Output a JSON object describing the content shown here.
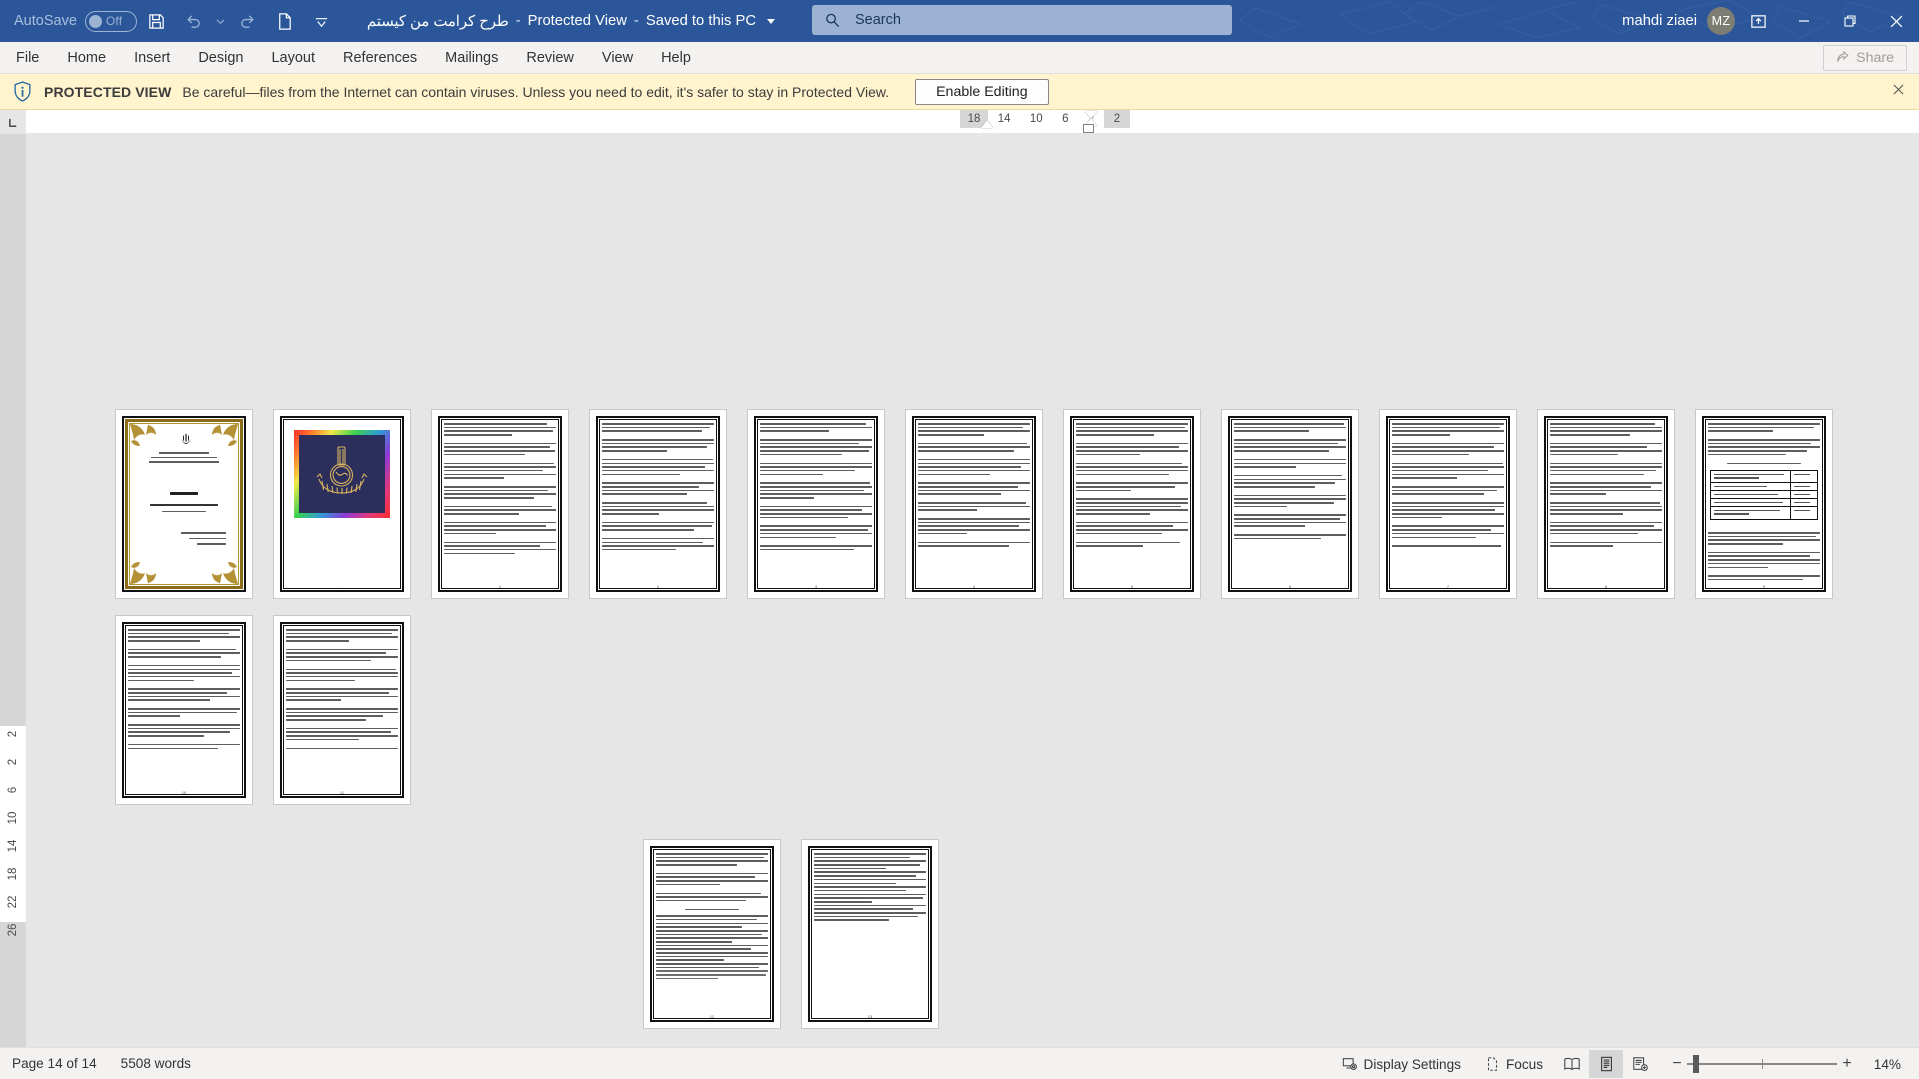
{
  "titlebar": {
    "autosave_label": "AutoSave",
    "autosave_state": "Off",
    "file_name": "طرح کرامت من کیستم",
    "separator1": "-",
    "protected_view": "Protected View",
    "separator2": "-",
    "save_location": "Saved to this PC",
    "icons": {
      "save": "save-icon",
      "undo": "undo-icon",
      "undo_more": "chevron-down-icon",
      "redo": "redo-icon",
      "new_doc": "new-document-icon",
      "customize_qat": "customize-quick-access-toolbar-icon"
    },
    "search": {
      "icon": "search-icon",
      "placeholder": "Search",
      "value": "Search"
    },
    "user_name": "mahdi ziaei",
    "user_initials": "MZ",
    "ribbon_display_options": "ribbon-display-options-icon",
    "minimize": "minimize-icon",
    "restore": "restore-icon",
    "close": "close-icon",
    "accent_color": "#2b579a"
  },
  "ribbon": {
    "tabs": [
      {
        "label": "File"
      },
      {
        "label": "Home"
      },
      {
        "label": "Insert"
      },
      {
        "label": "Design"
      },
      {
        "label": "Layout"
      },
      {
        "label": "References"
      },
      {
        "label": "Mailings"
      },
      {
        "label": "Review"
      },
      {
        "label": "View"
      },
      {
        "label": "Help"
      }
    ],
    "share_label": "Share",
    "share_icon": "share-icon"
  },
  "protected_view": {
    "icon": "info-shield-icon",
    "title": "PROTECTED VIEW",
    "message": "Be careful—files from the Internet can contain viruses. Unless you need to edit, it's safer to stay in Protected View.",
    "enable_button": "Enable Editing",
    "close_icon": "close-icon",
    "background": "#fff4ce"
  },
  "rulers": {
    "corner_icon": "tab-stop-left-icon",
    "horizontal_marks": [
      "18",
      "14",
      "10",
      "6",
      "2",
      "2"
    ],
    "vertical_marks": [
      "2",
      "2",
      "6",
      "10",
      "14",
      "18",
      "22",
      "26"
    ],
    "left_indent_marker": "first-line-indent-marker",
    "right_indent_marker": "hanging-indent-marker"
  },
  "document": {
    "page_count": 14,
    "pages": [
      {
        "number": 1,
        "kind": "title-page",
        "label": "Title page with decorative gold border and national emblem"
      },
      {
        "number": 2,
        "kind": "image-page",
        "label": "Calligraphy artwork page with rainbow gradient frame"
      },
      {
        "number": 3,
        "kind": "text",
        "label": "Persian body text page"
      },
      {
        "number": 4,
        "kind": "text",
        "label": "Persian body text page"
      },
      {
        "number": 5,
        "kind": "text",
        "label": "Persian body text page"
      },
      {
        "number": 6,
        "kind": "text",
        "label": "Persian body text page"
      },
      {
        "number": 7,
        "kind": "text",
        "label": "Persian body text page"
      },
      {
        "number": 8,
        "kind": "text",
        "label": "Persian body text page"
      },
      {
        "number": 9,
        "kind": "text",
        "label": "Persian body text page"
      },
      {
        "number": 10,
        "kind": "table",
        "label": "Persian text page containing a table"
      },
      {
        "number": 11,
        "kind": "text",
        "label": "Persian body text page"
      },
      {
        "number": 12,
        "kind": "text",
        "label": "Persian body text page"
      },
      {
        "number": 13,
        "kind": "text",
        "label": "References page"
      },
      {
        "number": 14,
        "kind": "text",
        "label": "References page (last page)"
      }
    ]
  },
  "statusbar": {
    "page_indicator": "Page 14 of 14",
    "word_count": "5508 words",
    "display_settings": "Display Settings",
    "display_settings_icon": "display-settings-icon",
    "focus": "Focus",
    "focus_icon": "focus-mode-icon",
    "view_read_mode": "read-mode-icon",
    "view_print_layout": "print-layout-icon",
    "view_web_layout": "web-layout-icon",
    "zoom_out": "−",
    "zoom_in": "+",
    "zoom_level": "14%"
  }
}
